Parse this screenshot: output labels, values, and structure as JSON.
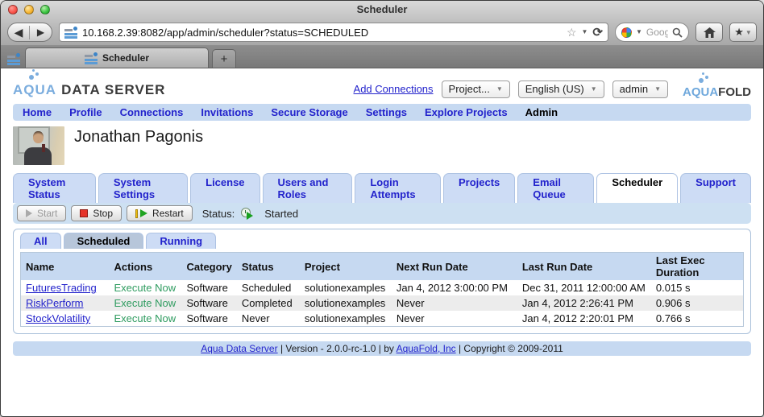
{
  "browser": {
    "title": "Scheduler",
    "url": "10.168.2.39:8082/app/admin/scheduler?status=SCHEDULED",
    "search_text": "Goog",
    "tab_label": "Scheduler"
  },
  "icons": {
    "back": "◀",
    "forward": "▶",
    "star": "☆",
    "caret": "▼",
    "reload": "⟳",
    "plus": "+",
    "bookmark_star": "★",
    "home": "⌂",
    "magnifier": "🔍"
  },
  "header": {
    "logo_aqua": "AQUA",
    "logo_rest": "DATA SERVER",
    "add_connections": "Add Connections",
    "project_select": "Project...",
    "language_select": "English (US)",
    "account_select": "admin",
    "aquafold_aqua": "AQUA",
    "aquafold_rest": "FOLD"
  },
  "nav": {
    "items": [
      "Home",
      "Profile",
      "Connections",
      "Invitations",
      "Secure Storage",
      "Settings",
      "Explore Projects",
      "Admin"
    ],
    "active": "Admin"
  },
  "user": {
    "name": "Jonathan Pagonis"
  },
  "admin_tabs": {
    "items": [
      "System Status",
      "System Settings",
      "License",
      "Users and Roles",
      "Login Attempts",
      "Projects",
      "Email Queue",
      "Scheduler",
      "Support"
    ],
    "active": "Scheduler"
  },
  "scheduler_toolbar": {
    "start": "Start",
    "stop": "Stop",
    "restart": "Restart",
    "status_label": "Status:",
    "status_value": "Started"
  },
  "view_tabs": {
    "items": [
      "All",
      "Scheduled",
      "Running"
    ],
    "active": "Scheduled"
  },
  "jobs_table": {
    "columns": [
      "Name",
      "Actions",
      "Category",
      "Status",
      "Project",
      "Next Run Date",
      "Last Run Date",
      "Last Exec Duration"
    ],
    "rows": [
      {
        "name": "FuturesTrading",
        "action": "Execute Now",
        "category": "Software",
        "status": "Scheduled",
        "project": "solutionexamples",
        "next_run": "Jan 4, 2012 3:00:00 PM",
        "last_run": "Dec 31, 2011 12:00:00 AM",
        "duration": "0.015 s"
      },
      {
        "name": "RiskPerform",
        "action": "Execute Now",
        "category": "Software",
        "status": "Completed",
        "project": "solutionexamples",
        "next_run": "Never",
        "last_run": "Jan 4, 2012 2:26:41 PM",
        "duration": "0.906 s"
      },
      {
        "name": "StockVolatility",
        "action": "Execute Now",
        "category": "Software",
        "status": "Never",
        "project": "solutionexamples",
        "next_run": "Never",
        "last_run": "Jan 4, 2012 2:20:01 PM",
        "duration": "0.766 s"
      }
    ]
  },
  "footer": {
    "link1": "Aqua Data Server",
    "sep1": " | Version - 2.0.0-rc-1.0 | by ",
    "link2": "AquaFold, Inc",
    "sep2": " | Copyright © 2009-2011"
  },
  "colors": {
    "bar_blue": "#c6d9f1",
    "link_blue": "#2323cc",
    "exec_green": "#2f9c60",
    "active_subtab": "#b7c6da"
  }
}
